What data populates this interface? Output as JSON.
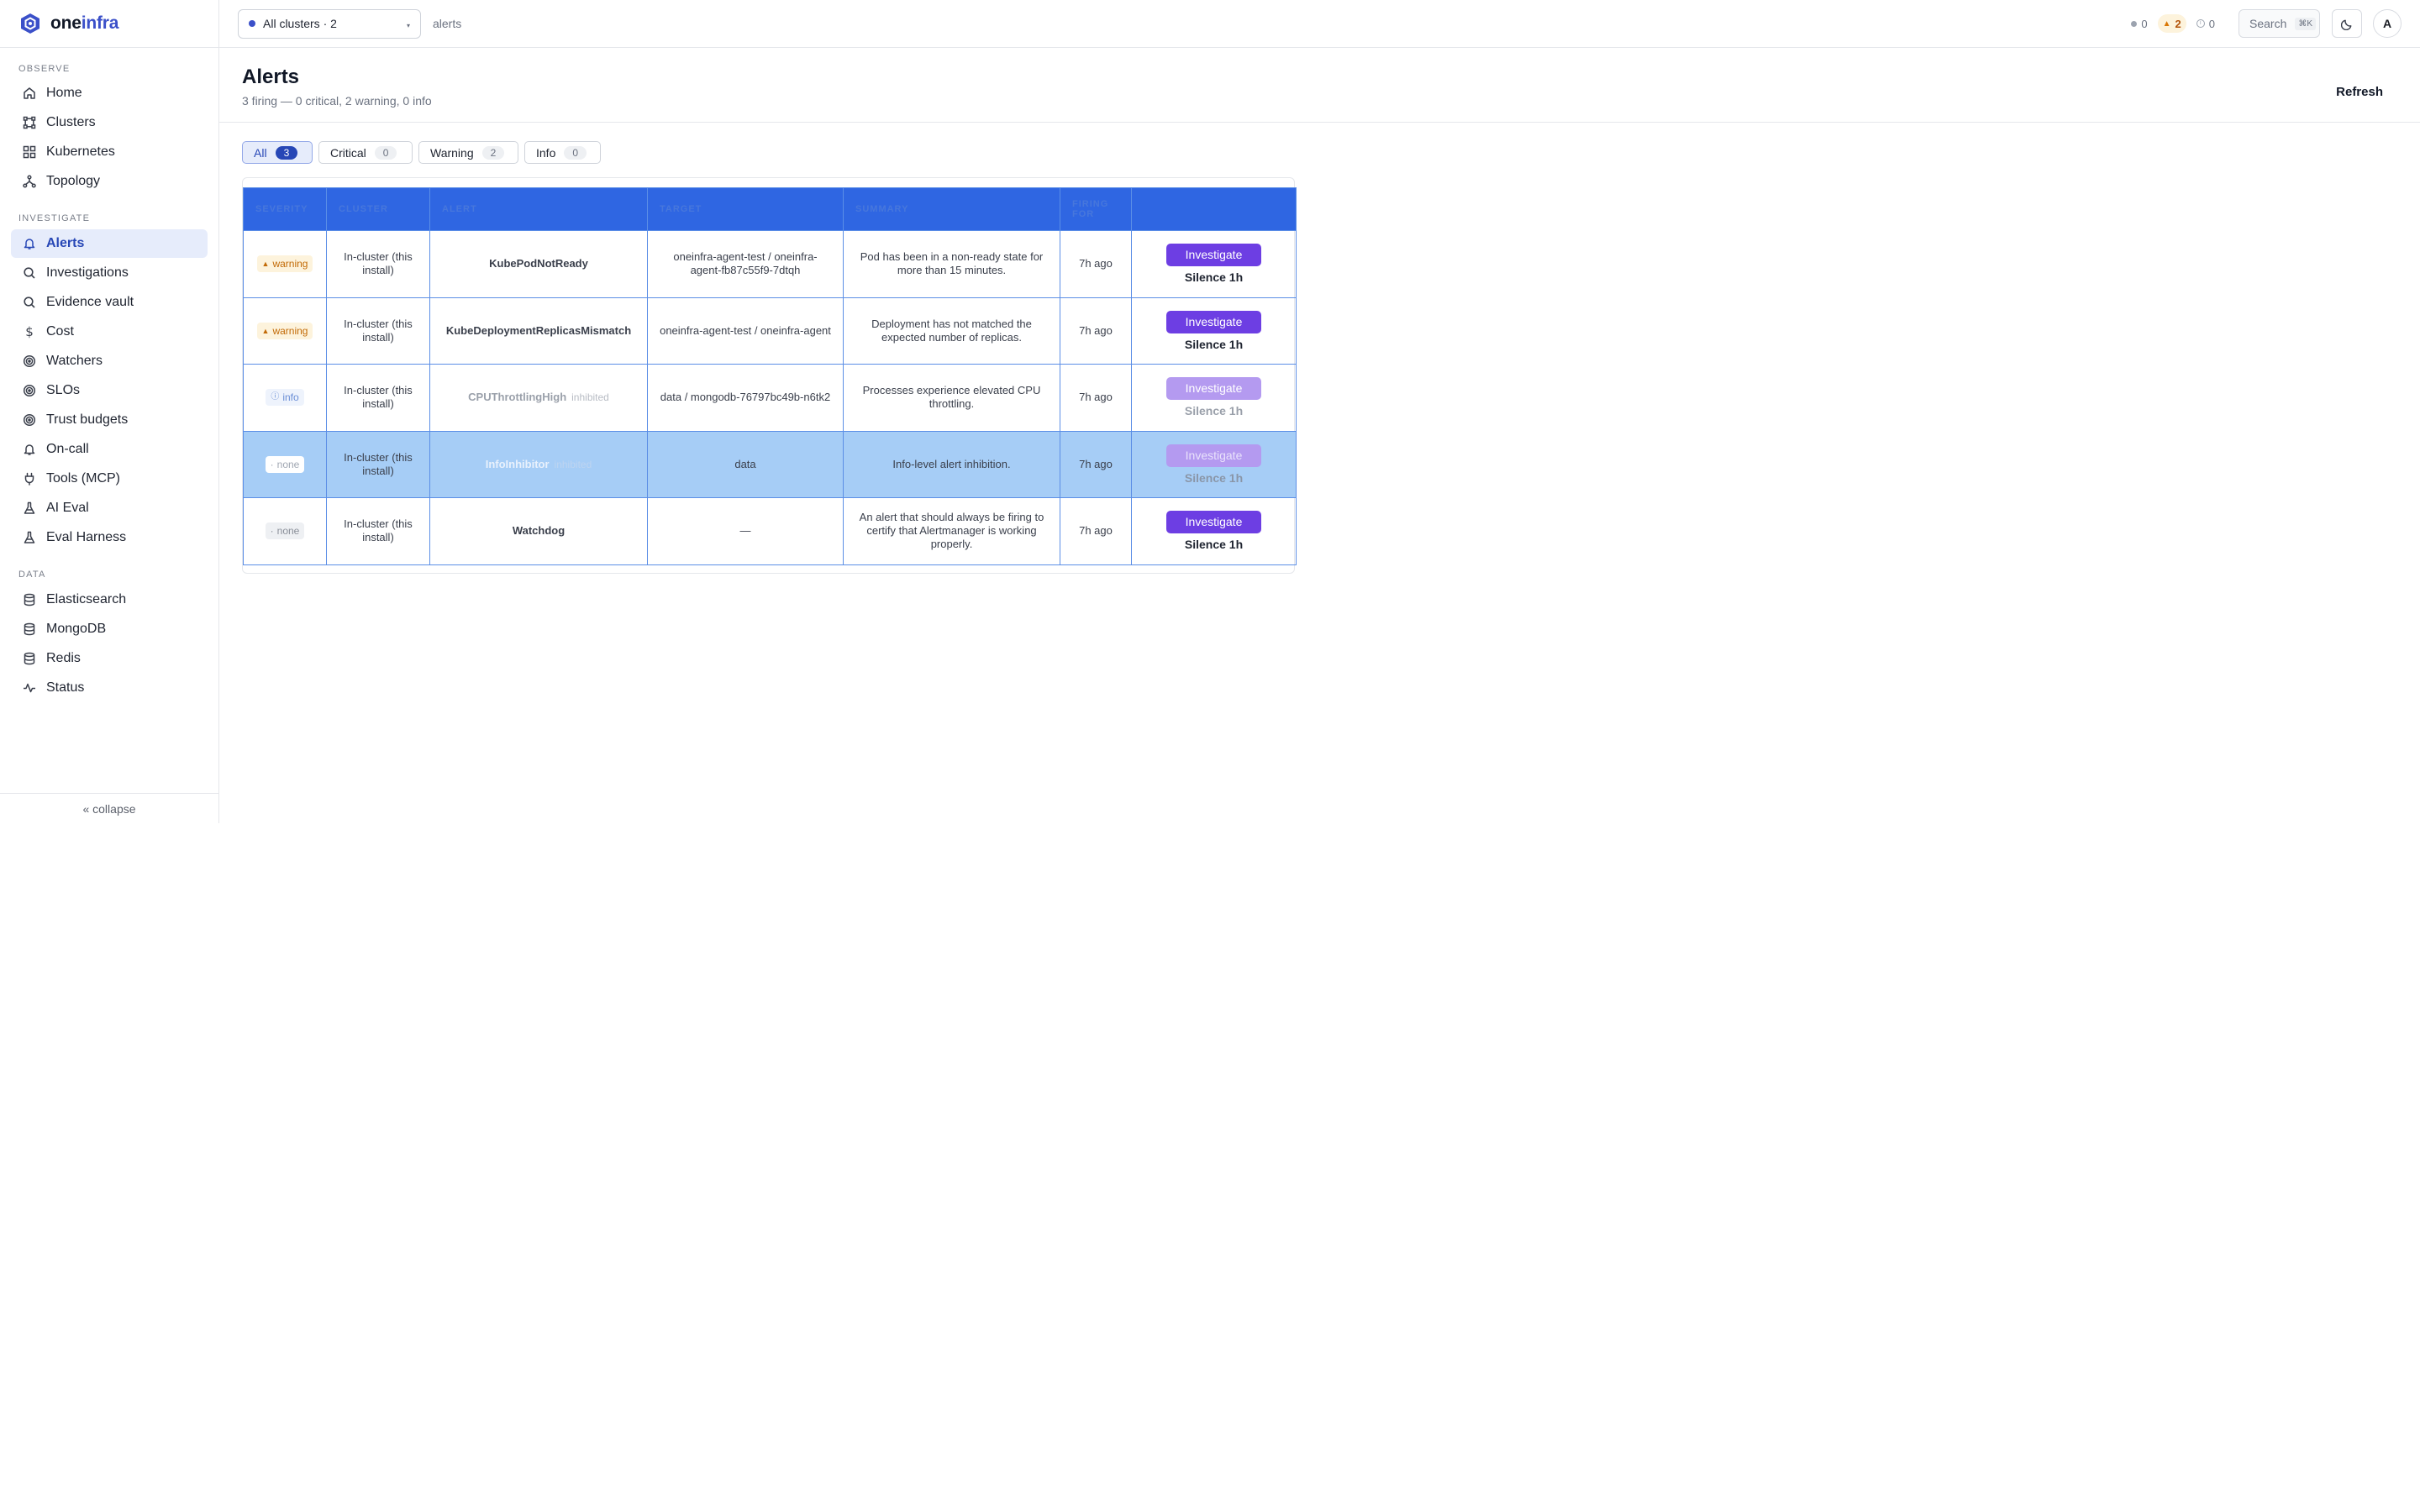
{
  "brand": {
    "name_part1": "one",
    "name_part2": "infra"
  },
  "sidebar": {
    "sections": [
      {
        "label": "OBSERVE",
        "items": [
          {
            "label": "Home",
            "icon": "home-icon"
          },
          {
            "label": "Clusters",
            "icon": "clusters-icon"
          },
          {
            "label": "Kubernetes",
            "icon": "grid-icon"
          },
          {
            "label": "Topology",
            "icon": "topology-icon"
          }
        ]
      },
      {
        "label": "INVESTIGATE",
        "items": [
          {
            "label": "Alerts",
            "icon": "bell-icon",
            "active": true
          },
          {
            "label": "Investigations",
            "icon": "search-icon"
          },
          {
            "label": "Evidence vault",
            "icon": "search-icon"
          },
          {
            "label": "Cost",
            "icon": "dollar-icon"
          },
          {
            "label": "Watchers",
            "icon": "target-icon"
          },
          {
            "label": "SLOs",
            "icon": "target-icon"
          },
          {
            "label": "Trust budgets",
            "icon": "target-icon"
          },
          {
            "label": "On-call",
            "icon": "bell-icon"
          },
          {
            "label": "Tools (MCP)",
            "icon": "plug-icon"
          },
          {
            "label": "AI Eval",
            "icon": "flask-icon"
          },
          {
            "label": "Eval Harness",
            "icon": "flask-icon"
          }
        ]
      },
      {
        "label": "DATA",
        "items": [
          {
            "label": "Elasticsearch",
            "icon": "database-icon"
          },
          {
            "label": "MongoDB",
            "icon": "database-icon"
          },
          {
            "label": "Redis",
            "icon": "database-icon"
          },
          {
            "label": "Status",
            "icon": "pulse-icon"
          }
        ]
      }
    ],
    "collapse_label": "« collapse"
  },
  "topbar": {
    "cluster_select": "All clusters · 2",
    "breadcrumb": "alerts",
    "stats": {
      "critical": "0",
      "warning": "2",
      "info": "0"
    },
    "search_label": "Search",
    "search_shortcut": "⌘K",
    "avatar_initial": "A"
  },
  "page": {
    "title": "Alerts",
    "subtitle": "3 firing — 0 critical, 2 warning, 0 info",
    "refresh_label": "Refresh"
  },
  "filters": [
    {
      "label": "All",
      "count": "3",
      "active": true
    },
    {
      "label": "Critical",
      "count": "0"
    },
    {
      "label": "Warning",
      "count": "2"
    },
    {
      "label": "Info",
      "count": "0"
    }
  ],
  "table": {
    "columns": [
      "SEVERITY",
      "CLUSTER",
      "ALERT",
      "TARGET",
      "SUMMARY",
      "FIRING FOR",
      ""
    ],
    "investigate_label": "Investigate",
    "silence_label": "Silence 1h",
    "rows": [
      {
        "severity": "warning",
        "severity_symbol": "▲",
        "cluster": "In-cluster (this install)",
        "alert": "KubePodNotReady",
        "inhibited_tag": "",
        "target": "oneinfra-agent-test / oneinfra-agent-fb87c55f9-7dtqh",
        "summary": "Pod has been in a non-ready state for more than 15 minutes.",
        "firing_for": "7h ago",
        "state": "normal"
      },
      {
        "severity": "warning",
        "severity_symbol": "▲",
        "cluster": "In-cluster (this install)",
        "alert": "KubeDeploymentReplicasMismatch",
        "inhibited_tag": "",
        "target": "oneinfra-agent-test / oneinfra-agent",
        "summary": "Deployment has not matched the expected number of replicas.",
        "firing_for": "7h ago",
        "state": "normal"
      },
      {
        "severity": "info",
        "severity_symbol": "ⓘ",
        "cluster": "In-cluster (this install)",
        "alert": "CPUThrottlingHigh",
        "inhibited_tag": "inhibited",
        "target": "data / mongodb-76797bc49b-n6tk2",
        "summary": "Processes experience elevated CPU throttling.",
        "firing_for": "7h ago",
        "state": "inhibited"
      },
      {
        "severity": "none",
        "severity_symbol": "·",
        "cluster": "In-cluster (this install)",
        "alert": "InfoInhibitor",
        "inhibited_tag": "inhibited",
        "target": "data",
        "summary": "Info-level alert inhibition.",
        "firing_for": "7h ago",
        "state": "selected"
      },
      {
        "severity": "none",
        "severity_symbol": "·",
        "cluster": "In-cluster (this install)",
        "alert": "Watchdog",
        "inhibited_tag": "",
        "target": "—",
        "summary": "An alert that should always be firing to certify that Alertmanager is working properly.",
        "firing_for": "7h ago",
        "state": "normal"
      }
    ]
  },
  "colors": {
    "accent": "#2747b6",
    "brand": "#3b50c9",
    "investigate": "#6d3ee3",
    "warning": "#c26a06",
    "table_header": "#2f66e2"
  }
}
